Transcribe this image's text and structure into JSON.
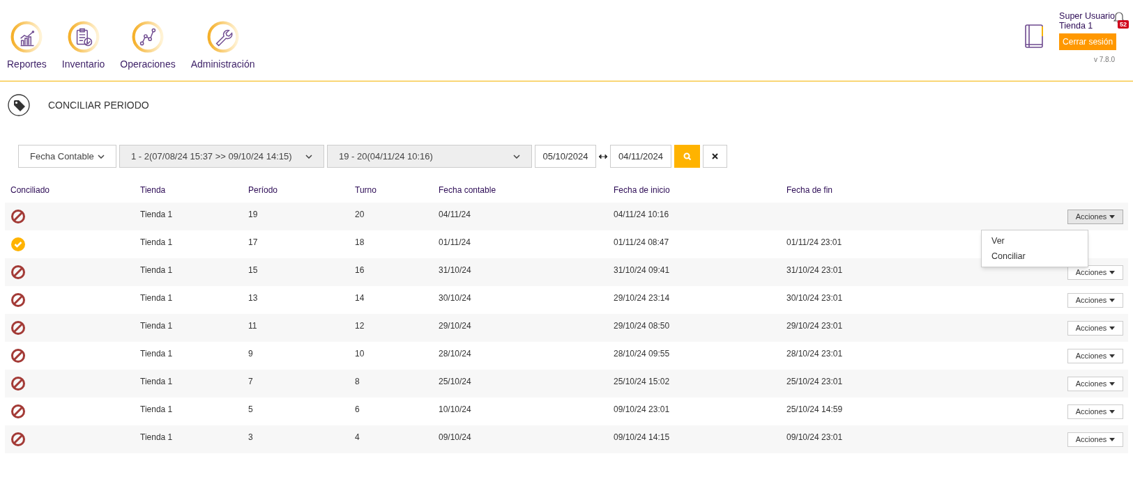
{
  "nav": [
    {
      "kind": "reports",
      "label": "Reportes"
    },
    {
      "kind": "inventory",
      "label": "Inventario"
    },
    {
      "kind": "operations",
      "label": "Operaciones"
    },
    {
      "kind": "admin",
      "label": "Administración"
    }
  ],
  "user": {
    "name": "Super Usuario",
    "store": "Tienda 1",
    "notifications": "52",
    "logout": "Cerrar sesión",
    "version": "v 7.8.0"
  },
  "page_title": "CONCILIAR PERIODO",
  "filters": {
    "mode": "Fecha Contable",
    "from_period": "1 - 2(07/08/24 15:37 >> 09/10/24 14:15)",
    "to_period": "19 - 20(04/11/24 10:16)",
    "date_from": "05/10/2024",
    "date_to": "04/11/2024"
  },
  "table": {
    "columns": [
      "Conciliado",
      "Tienda",
      "Período",
      "Turno",
      "Fecha contable",
      "Fecha de inicio",
      "Fecha de fin"
    ],
    "rows": [
      {
        "conciliado": false,
        "tienda": "Tienda 1",
        "periodo": "19",
        "turno": "20",
        "fecha_contable": "04/11/24",
        "fecha_inicio": "04/11/24 10:16",
        "actions": "Acciones",
        "expanded": true
      },
      {
        "conciliado": true,
        "tienda": "Tienda 1",
        "periodo": "17",
        "turno": "18",
        "fecha_contable": "01/11/24",
        "fecha_inicio": "01/11/24 08:47",
        "fecha_fin": "01/11/24 23:01"
      },
      {
        "conciliado": false,
        "tienda": "Tienda 1",
        "periodo": "15",
        "turno": "16",
        "fecha_contable": "31/10/24",
        "fecha_inicio": "31/10/24 09:41",
        "fecha_fin": "31/10/24 23:01",
        "actions": "Acciones",
        "expanded": false
      },
      {
        "conciliado": false,
        "tienda": "Tienda 1",
        "periodo": "13",
        "turno": "14",
        "fecha_contable": "30/10/24",
        "fecha_inicio": "29/10/24 23:14",
        "fecha_fin": "30/10/24 23:01",
        "actions": "Acciones",
        "expanded": false
      },
      {
        "conciliado": false,
        "tienda": "Tienda 1",
        "periodo": "11",
        "turno": "12",
        "fecha_contable": "29/10/24",
        "fecha_inicio": "29/10/24 08:50",
        "fecha_fin": "29/10/24 23:01",
        "actions": "Acciones",
        "expanded": false
      },
      {
        "conciliado": false,
        "tienda": "Tienda 1",
        "periodo": "9",
        "turno": "10",
        "fecha_contable": "28/10/24",
        "fecha_inicio": "28/10/24 09:55",
        "fecha_fin": "28/10/24 23:01",
        "actions": "Acciones",
        "expanded": false
      },
      {
        "conciliado": false,
        "tienda": "Tienda 1",
        "periodo": "7",
        "turno": "8",
        "fecha_contable": "25/10/24",
        "fecha_inicio": "25/10/24 15:02",
        "fecha_fin": "25/10/24 23:01",
        "actions": "Acciones",
        "expanded": false
      },
      {
        "conciliado": false,
        "tienda": "Tienda 1",
        "periodo": "5",
        "turno": "6",
        "fecha_contable": "10/10/24",
        "fecha_inicio": "09/10/24 23:01",
        "fecha_fin": "25/10/24 14:59",
        "actions": "Acciones",
        "expanded": false
      },
      {
        "conciliado": false,
        "tienda": "Tienda 1",
        "periodo": "3",
        "turno": "4",
        "fecha_contable": "09/10/24",
        "fecha_inicio": "09/10/24 14:15",
        "fecha_fin": "09/10/24 23:01",
        "actions": "Acciones",
        "expanded": false
      }
    ]
  },
  "action_menu": [
    "Ver",
    "Conciliar"
  ]
}
